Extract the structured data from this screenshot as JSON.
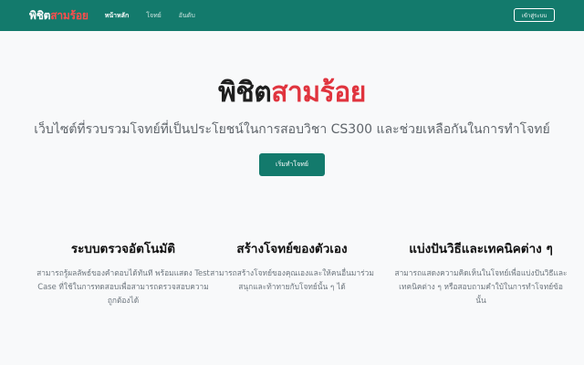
{
  "navbar": {
    "brand_part1": "พิชิต",
    "brand_part2": "สามร้อย",
    "links": [
      "หน้าหลัก",
      "โจทย์",
      "อันดับ"
    ],
    "login_label": "เข้าสู่ระบบ",
    "accent_color": "#137a6c"
  },
  "hero": {
    "title_part1": "พิชิต",
    "title_part2": "สามร้อย",
    "subtitle": "เว็บไซต์ที่รวบรวมโจทย์ที่เป็นประโยชน์ในการสอบวิชา CS300 และช่วยเหลือกันในการทำโจทย์",
    "start_label": "เริ่มทำโจทย์"
  },
  "features": [
    {
      "title": "ระบบตรวจอัตโนมัติ",
      "description": "สามารถรู้ผลลัพธ์ของคำตอบได้ทันที พร้อมแสดง Test Case ที่ใช้ในการทดสอบเพื่อสามารถตรวจสอบความถูกต้องได้"
    },
    {
      "title": "สร้างโจทย์ของตัวเอง",
      "description": "สามารถสร้างโจทย์ของคุณเองและให้คนอื่นมาร่วมสนุกและท้าทายกับโจทย์นั้น ๆ ได้"
    },
    {
      "title": "แบ่งปันวิธีและเทคนิคต่าง ๆ",
      "description": "สามารถแสดงความคิดเห็นในโจทย์เพื่อแบ่งปันวิธีและเทคนิคต่าง ๆ หรือสอบถามคำใบ้ในการทำโจทย์ข้อนั้น"
    }
  ]
}
